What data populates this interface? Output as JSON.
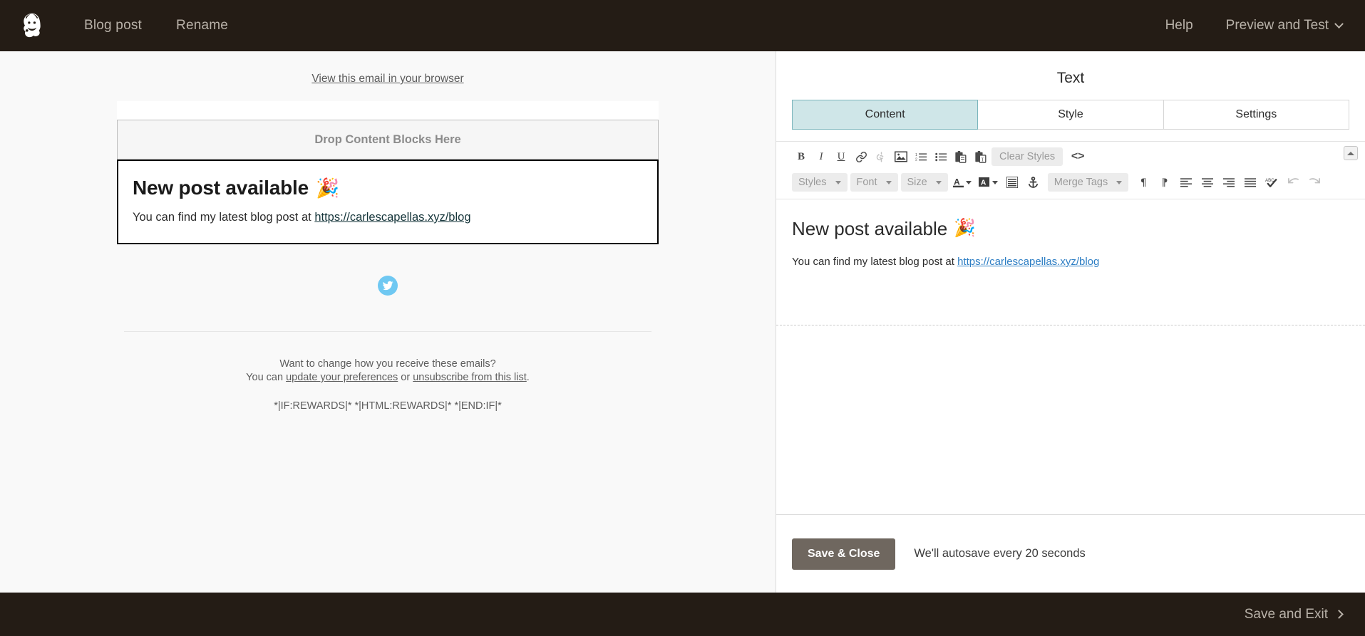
{
  "topbar": {
    "logo_icon": "mailchimp-freddie-logo",
    "nav": [
      {
        "label": "Blog post"
      },
      {
        "label": "Rename"
      }
    ],
    "right": [
      {
        "label": "Help"
      },
      {
        "label": "Preview and Test",
        "icon": "chevron-down-icon"
      }
    ]
  },
  "preview": {
    "view_in_browser": "View this email in your browser",
    "dropzone_label": "Drop Content Blocks Here",
    "text_block": {
      "heading": "New post available",
      "heading_emoji": "🎉",
      "paragraph_prefix": "You can find my latest blog post at ",
      "link_text": "https://carlescapellas.xyz/blog"
    },
    "social": {
      "icon": "twitter-icon"
    },
    "footer": {
      "line1": "Want to change how you receive these emails?",
      "line2_prefix": "You can ",
      "link1": "update your preferences",
      "line2_middle": " or ",
      "link2": "unsubscribe from this list",
      "line2_suffix": ".",
      "merge_tags": "*|IF:REWARDS|* *|HTML:REWARDS|* *|END:IF|*"
    }
  },
  "panel": {
    "title": "Text",
    "tabs": [
      {
        "label": "Content",
        "active": true
      },
      {
        "label": "Style",
        "active": false
      },
      {
        "label": "Settings",
        "active": false
      }
    ],
    "toolbar": {
      "row1": [
        {
          "name": "bold-icon",
          "glyph": "B"
        },
        {
          "name": "italic-icon",
          "glyph": "I"
        },
        {
          "name": "underline-icon",
          "glyph": "U"
        },
        {
          "name": "link-icon",
          "glyph": "🔗"
        },
        {
          "name": "unlink-icon",
          "glyph": "⛓"
        },
        {
          "name": "image-icon",
          "glyph": "🖼"
        },
        {
          "name": "ordered-list-icon",
          "glyph": "≡"
        },
        {
          "name": "unordered-list-icon",
          "glyph": "≔"
        },
        {
          "name": "paste-icon",
          "glyph": "📋"
        },
        {
          "name": "paste-as-text-icon",
          "glyph": "📋"
        }
      ],
      "clear_styles_label": "Clear Styles",
      "code_view_label": "<>",
      "row2_dropdowns": [
        {
          "label": "Styles"
        },
        {
          "label": "Font"
        },
        {
          "label": "Size"
        }
      ],
      "merge_tags_label": "Merge Tags",
      "collapse_icon": "collapse-up-icon"
    },
    "editor": {
      "heading": "New post available",
      "heading_emoji": "🎉",
      "paragraph_prefix": "You can find my latest blog post at ",
      "link_text": "https://carlescapellas.xyz/blog"
    },
    "footer": {
      "save_close_label": "Save & Close",
      "autosave_text": "We'll autosave every 20 seconds"
    }
  },
  "bottombar": {
    "save_exit_label": "Save and Exit",
    "icon": "chevron-right-icon"
  },
  "colors": {
    "dark_bar": "#241c15",
    "tab_active_bg": "#cfe6e8",
    "tab_active_border": "#7cb6bd",
    "save_button_bg": "#6f675f",
    "editor_link": "#2d7ec4",
    "twitter_blue": "#6fc8f2"
  }
}
